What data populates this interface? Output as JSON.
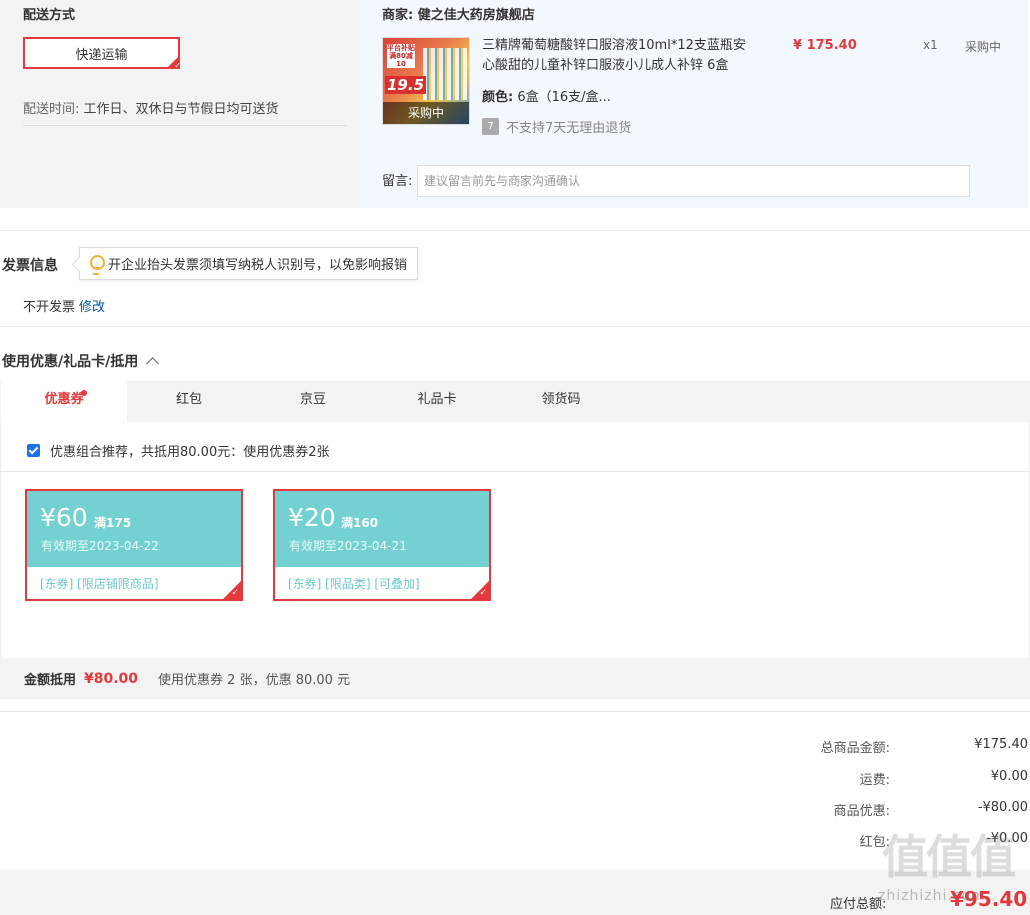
{
  "shipping": {
    "section_label": "配送方式",
    "method_label": "快递运输",
    "time_label": "配送时间:",
    "time_value": "工作日、双休日与节假日均可送货"
  },
  "store": {
    "label": "商家:",
    "name": "健之佳大药房旗舰店",
    "product": {
      "image_overlay": "采购中",
      "image_badge_text": "平台补贴 满80减10",
      "image_price": "19.5",
      "title": "三精牌葡萄糖酸锌口服溶液10ml*12支蓝瓶安心酸甜的儿童补锌口服液小儿成人补锌 6盒",
      "price": "¥ 175.40",
      "qty": "x1",
      "status": "采购中",
      "color_label": "颜色:",
      "color_value": "6盒（16支/盒...",
      "no_return_icon": "7",
      "no_return_text": "不支持7天无理由退货"
    },
    "message_label": "留言:",
    "message_placeholder": "建议留言前先与商家沟通确认"
  },
  "invoice": {
    "title": "发票信息",
    "tip": "开企业抬头发票须填写纳税人识别号，以免影响报销",
    "value": "不开发票",
    "edit_label": "修改"
  },
  "coupons": {
    "title": "使用优惠/礼品卡/抵用",
    "tabs": [
      {
        "label": "优惠券",
        "active": true,
        "dot": true
      },
      {
        "label": "红包",
        "active": false
      },
      {
        "label": "京豆",
        "active": false
      },
      {
        "label": "礼品卡",
        "active": false
      },
      {
        "label": "领货码",
        "active": false
      }
    ],
    "recommend_text": "优惠组合推荐，共抵用80.00元：使用优惠券2张",
    "recommend_checked": true,
    "items": [
      {
        "amount": "¥60",
        "condition": "满175",
        "valid": "有效期至2023-04-22",
        "tags": "[东券] [限店铺限商品]"
      },
      {
        "amount": "¥20",
        "condition": "满160",
        "valid": "有效期至2023-04-21",
        "tags": "[东券] [限品类] [可叠加]"
      }
    ],
    "discount_label": "金额抵用",
    "discount_amount": "¥80.00",
    "discount_desc": "使用优惠券 2 张，优惠 80.00 元"
  },
  "summary": {
    "rows": [
      {
        "label": "总商品金额:",
        "value": "¥175.40"
      },
      {
        "label": "运费:",
        "value": "¥0.00"
      },
      {
        "label": "商品优惠:",
        "value": "-¥80.00"
      },
      {
        "label": "红包:",
        "value": "-¥0.00"
      }
    ],
    "total_label": "应付总额:",
    "total_value": "¥95.40"
  },
  "watermark": {
    "logo": "值值值",
    "text": "zhizhizhi.com"
  },
  "colors": {
    "accent": "#e4393c",
    "coupon_teal": "#74d1d2",
    "link_blue": "#005aa0",
    "store_bg": "#f3f8fe",
    "panel_bg": "#f3f3f3"
  }
}
